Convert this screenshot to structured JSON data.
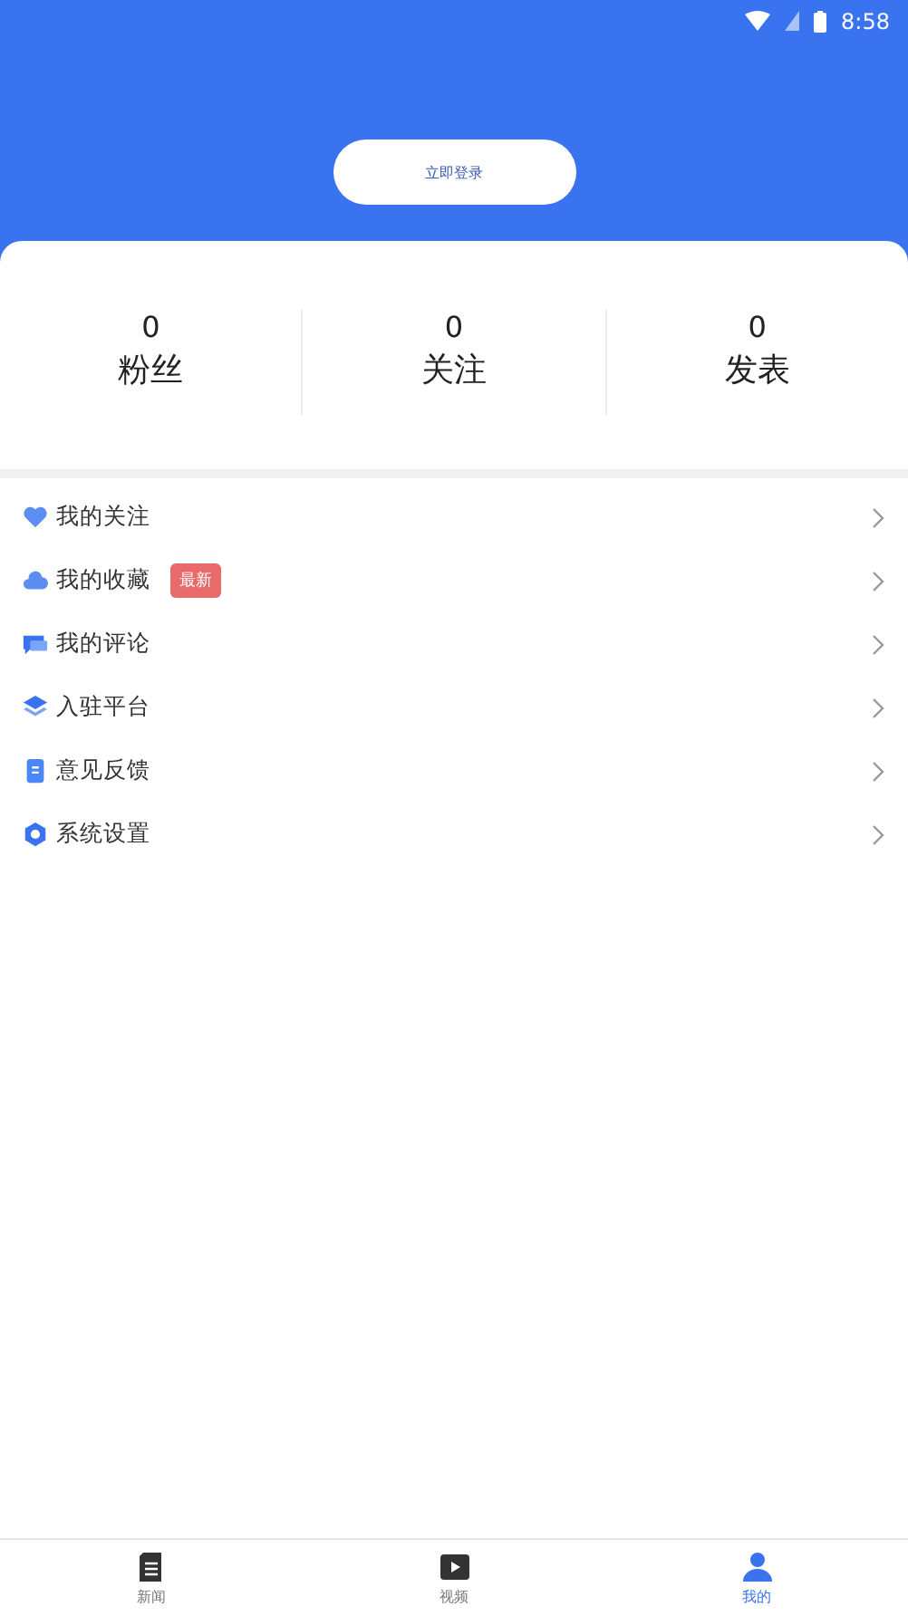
{
  "status_bar": {
    "time": "8:58"
  },
  "login_button": "立即登录",
  "stats": [
    {
      "value": "0",
      "label": "粉丝"
    },
    {
      "value": "0",
      "label": "关注"
    },
    {
      "value": "0",
      "label": "发表"
    }
  ],
  "menu": [
    {
      "kind": "heart",
      "label": "我的关注"
    },
    {
      "kind": "cloud",
      "label": "我的收藏",
      "badge": "最新"
    },
    {
      "kind": "comment",
      "label": "我的评论"
    },
    {
      "kind": "layers",
      "label": "入驻平台"
    },
    {
      "kind": "doc",
      "label": "意见反馈"
    },
    {
      "kind": "gear",
      "label": "系统设置"
    }
  ],
  "tabs": [
    {
      "kind": "news",
      "label": "新闻",
      "selected": false
    },
    {
      "kind": "video",
      "label": "视频",
      "selected": false
    },
    {
      "kind": "me",
      "label": "我的",
      "selected": true
    }
  ]
}
